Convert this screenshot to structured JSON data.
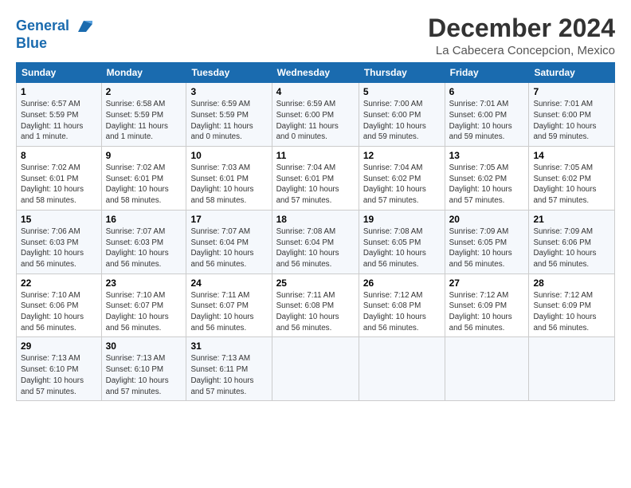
{
  "logo": {
    "line1": "General",
    "line2": "Blue"
  },
  "title": "December 2024",
  "subtitle": "La Cabecera Concepcion, Mexico",
  "days_of_week": [
    "Sunday",
    "Monday",
    "Tuesday",
    "Wednesday",
    "Thursday",
    "Friday",
    "Saturday"
  ],
  "weeks": [
    [
      {
        "day": "1",
        "info": "Sunrise: 6:57 AM\nSunset: 5:59 PM\nDaylight: 11 hours\nand 1 minute."
      },
      {
        "day": "2",
        "info": "Sunrise: 6:58 AM\nSunset: 5:59 PM\nDaylight: 11 hours\nand 1 minute."
      },
      {
        "day": "3",
        "info": "Sunrise: 6:59 AM\nSunset: 5:59 PM\nDaylight: 11 hours\nand 0 minutes."
      },
      {
        "day": "4",
        "info": "Sunrise: 6:59 AM\nSunset: 6:00 PM\nDaylight: 11 hours\nand 0 minutes."
      },
      {
        "day": "5",
        "info": "Sunrise: 7:00 AM\nSunset: 6:00 PM\nDaylight: 10 hours\nand 59 minutes."
      },
      {
        "day": "6",
        "info": "Sunrise: 7:01 AM\nSunset: 6:00 PM\nDaylight: 10 hours\nand 59 minutes."
      },
      {
        "day": "7",
        "info": "Sunrise: 7:01 AM\nSunset: 6:00 PM\nDaylight: 10 hours\nand 59 minutes."
      }
    ],
    [
      {
        "day": "8",
        "info": "Sunrise: 7:02 AM\nSunset: 6:01 PM\nDaylight: 10 hours\nand 58 minutes."
      },
      {
        "day": "9",
        "info": "Sunrise: 7:02 AM\nSunset: 6:01 PM\nDaylight: 10 hours\nand 58 minutes."
      },
      {
        "day": "10",
        "info": "Sunrise: 7:03 AM\nSunset: 6:01 PM\nDaylight: 10 hours\nand 58 minutes."
      },
      {
        "day": "11",
        "info": "Sunrise: 7:04 AM\nSunset: 6:01 PM\nDaylight: 10 hours\nand 57 minutes."
      },
      {
        "day": "12",
        "info": "Sunrise: 7:04 AM\nSunset: 6:02 PM\nDaylight: 10 hours\nand 57 minutes."
      },
      {
        "day": "13",
        "info": "Sunrise: 7:05 AM\nSunset: 6:02 PM\nDaylight: 10 hours\nand 57 minutes."
      },
      {
        "day": "14",
        "info": "Sunrise: 7:05 AM\nSunset: 6:02 PM\nDaylight: 10 hours\nand 57 minutes."
      }
    ],
    [
      {
        "day": "15",
        "info": "Sunrise: 7:06 AM\nSunset: 6:03 PM\nDaylight: 10 hours\nand 56 minutes."
      },
      {
        "day": "16",
        "info": "Sunrise: 7:07 AM\nSunset: 6:03 PM\nDaylight: 10 hours\nand 56 minutes."
      },
      {
        "day": "17",
        "info": "Sunrise: 7:07 AM\nSunset: 6:04 PM\nDaylight: 10 hours\nand 56 minutes."
      },
      {
        "day": "18",
        "info": "Sunrise: 7:08 AM\nSunset: 6:04 PM\nDaylight: 10 hours\nand 56 minutes."
      },
      {
        "day": "19",
        "info": "Sunrise: 7:08 AM\nSunset: 6:05 PM\nDaylight: 10 hours\nand 56 minutes."
      },
      {
        "day": "20",
        "info": "Sunrise: 7:09 AM\nSunset: 6:05 PM\nDaylight: 10 hours\nand 56 minutes."
      },
      {
        "day": "21",
        "info": "Sunrise: 7:09 AM\nSunset: 6:06 PM\nDaylight: 10 hours\nand 56 minutes."
      }
    ],
    [
      {
        "day": "22",
        "info": "Sunrise: 7:10 AM\nSunset: 6:06 PM\nDaylight: 10 hours\nand 56 minutes."
      },
      {
        "day": "23",
        "info": "Sunrise: 7:10 AM\nSunset: 6:07 PM\nDaylight: 10 hours\nand 56 minutes."
      },
      {
        "day": "24",
        "info": "Sunrise: 7:11 AM\nSunset: 6:07 PM\nDaylight: 10 hours\nand 56 minutes."
      },
      {
        "day": "25",
        "info": "Sunrise: 7:11 AM\nSunset: 6:08 PM\nDaylight: 10 hours\nand 56 minutes."
      },
      {
        "day": "26",
        "info": "Sunrise: 7:12 AM\nSunset: 6:08 PM\nDaylight: 10 hours\nand 56 minutes."
      },
      {
        "day": "27",
        "info": "Sunrise: 7:12 AM\nSunset: 6:09 PM\nDaylight: 10 hours\nand 56 minutes."
      },
      {
        "day": "28",
        "info": "Sunrise: 7:12 AM\nSunset: 6:09 PM\nDaylight: 10 hours\nand 56 minutes."
      }
    ],
    [
      {
        "day": "29",
        "info": "Sunrise: 7:13 AM\nSunset: 6:10 PM\nDaylight: 10 hours\nand 57 minutes."
      },
      {
        "day": "30",
        "info": "Sunrise: 7:13 AM\nSunset: 6:10 PM\nDaylight: 10 hours\nand 57 minutes."
      },
      {
        "day": "31",
        "info": "Sunrise: 7:13 AM\nSunset: 6:11 PM\nDaylight: 10 hours\nand 57 minutes."
      },
      null,
      null,
      null,
      null
    ]
  ]
}
